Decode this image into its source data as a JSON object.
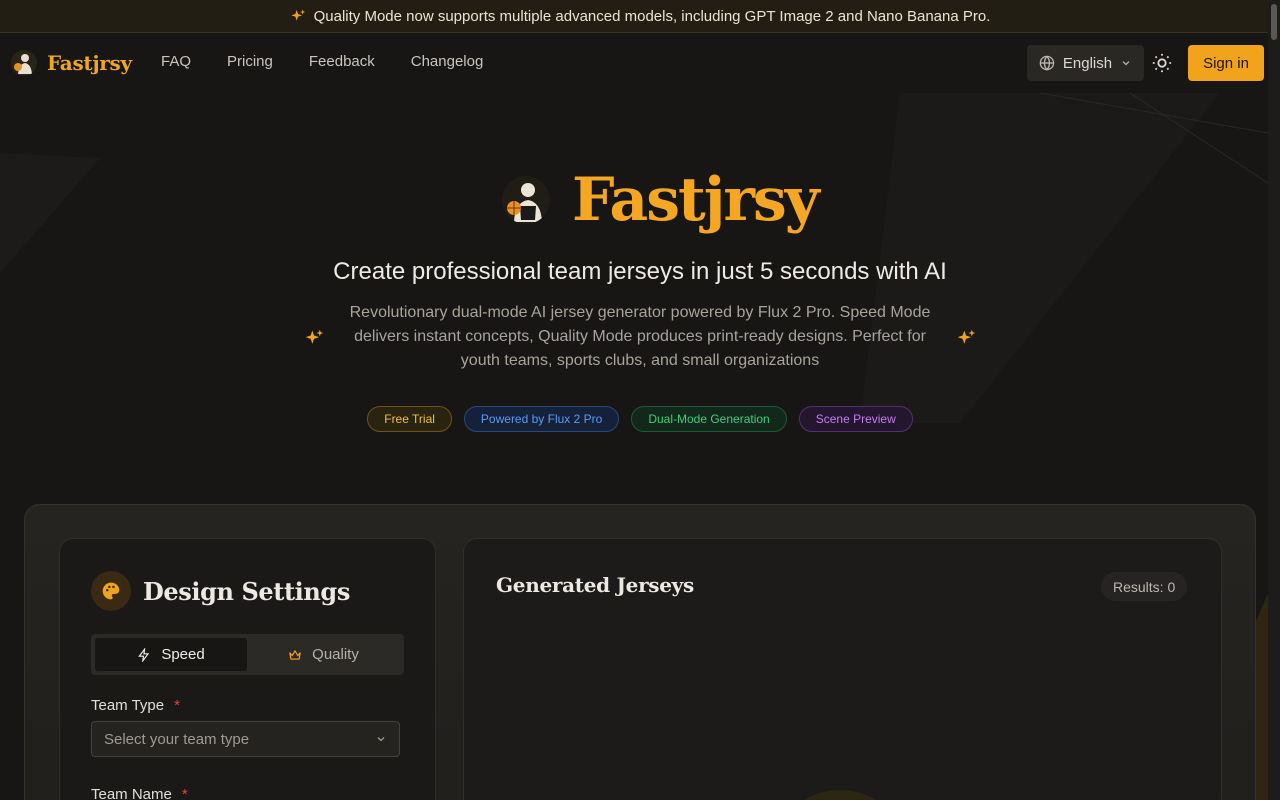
{
  "announcement": {
    "text": "Quality Mode now supports multiple advanced models, including GPT Image 2 and Nano Banana Pro.",
    "icon": "sparkles-icon"
  },
  "nav": {
    "brand": "Fastjrsy",
    "links": [
      "FAQ",
      "Pricing",
      "Feedback",
      "Changelog"
    ],
    "language": "English",
    "sign_in": "Sign in"
  },
  "hero": {
    "title": "Fastjrsy",
    "subtitle": "Create professional team jerseys in just 5 seconds with AI",
    "description": "Revolutionary dual-mode AI jersey generator powered by Flux 2 Pro. Speed Mode delivers instant concepts, Quality Mode produces print-ready designs. Perfect for youth teams, sports clubs, and small organizations",
    "badges": [
      {
        "label": "Free Trial",
        "color": "#f0c040",
        "border": "#6a5418",
        "bg": "#2a2310"
      },
      {
        "label": "Powered by Flux 2 Pro",
        "color": "#5b9cf0",
        "border": "#274a7a",
        "bg": "#15213a"
      },
      {
        "label": "Dual-Mode Generation",
        "color": "#3fcf7a",
        "border": "#1e5a35",
        "bg": "#12281b"
      },
      {
        "label": "Scene Preview",
        "color": "#c77df0",
        "border": "#553070",
        "bg": "#24162e"
      }
    ]
  },
  "settings": {
    "title": "Design Settings",
    "modes": {
      "speed": "Speed",
      "quality": "Quality",
      "selected": "Speed"
    },
    "team_type_label": "Team Type",
    "team_type_placeholder": "Select your team type",
    "team_name_label": "Team Name",
    "required_mark": "*"
  },
  "results": {
    "title": "Generated Jerseys",
    "count_label": "Results: 0"
  },
  "colors": {
    "accent": "#f2a31c",
    "background": "#171614"
  }
}
